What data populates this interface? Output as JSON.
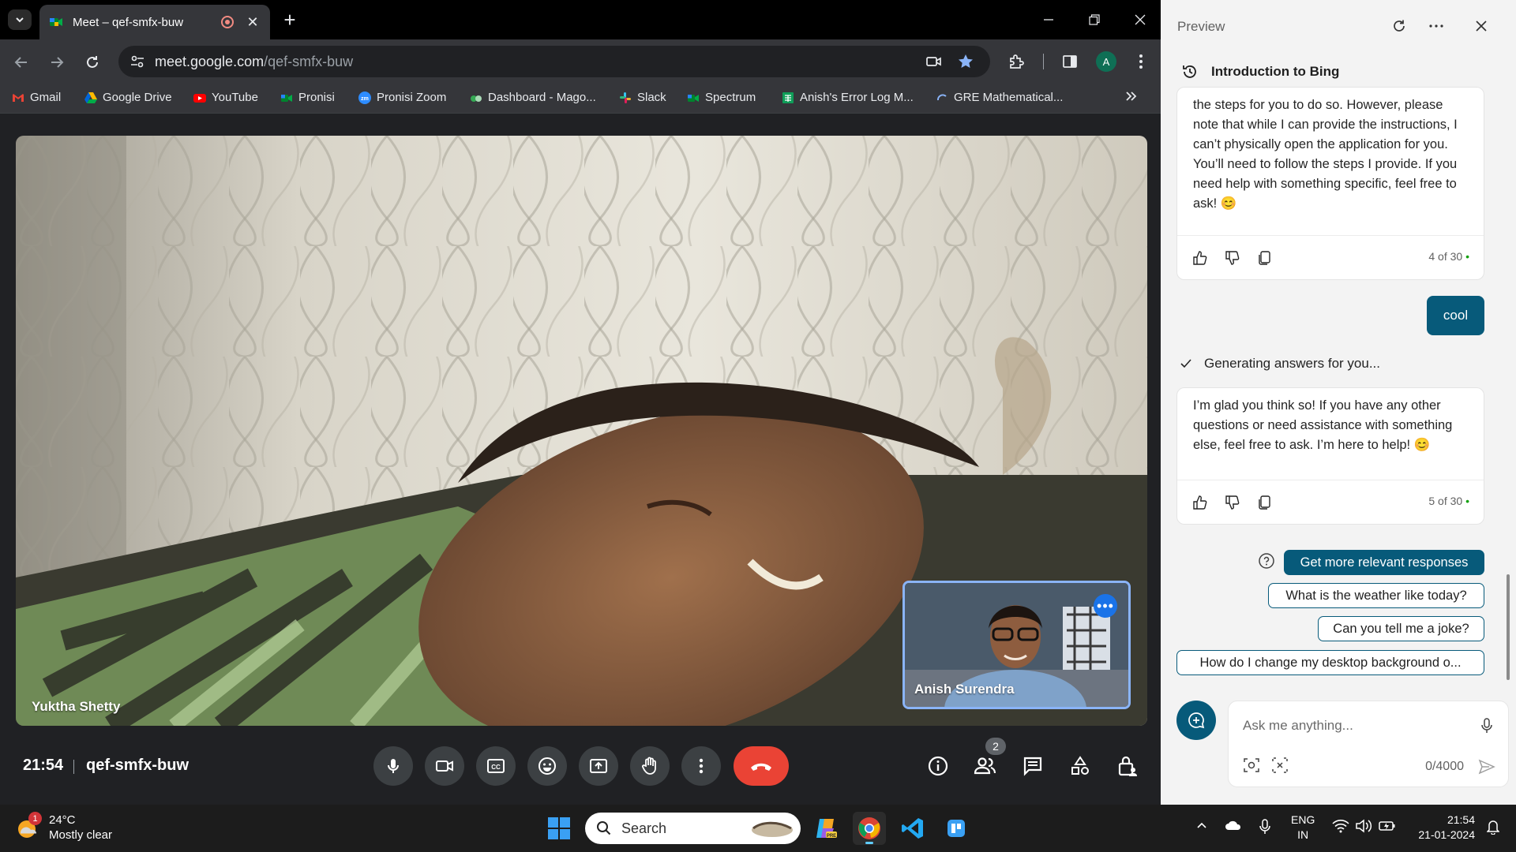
{
  "browser": {
    "tab_title": "Meet – qef-smfx-buw",
    "url_host": "meet.google.com",
    "url_path": "/qef-smfx-buw",
    "profile_initial": "A",
    "bookmarks": [
      {
        "label": "Gmail",
        "icon": "gmail-icon"
      },
      {
        "label": "Google Drive",
        "icon": "google-drive-icon"
      },
      {
        "label": "YouTube",
        "icon": "youtube-icon"
      },
      {
        "label": "Pronisi",
        "icon": "meet-icon"
      },
      {
        "label": "Pronisi Zoom",
        "icon": "zoom-icon"
      },
      {
        "label": "Dashboard - Mago...",
        "icon": "dashboard-icon"
      },
      {
        "label": "Slack",
        "icon": "slack-icon"
      },
      {
        "label": "Spectrum",
        "icon": "meet-icon"
      },
      {
        "label": "Anish's Error Log M...",
        "icon": "sheets-icon"
      },
      {
        "label": "GRE Mathematical...",
        "icon": "loader-icon"
      }
    ]
  },
  "meet": {
    "main_participant": "Yuktha Shetty",
    "self_participant": "Anish Surendra",
    "time": "21:54",
    "meeting_code": "qef-smfx-buw",
    "people_count": "2",
    "hangup_color": "#ea4335"
  },
  "copilot": {
    "header_title": "Preview",
    "conversation_title": "Introduction to Bing",
    "messages": [
      {
        "text": "the steps for you to do so. However, please note that while I can provide the instructions, I can’t physically open the application for you. You’ll need to follow the steps I provide. If you need help with something specific, feel free to ask! 😊",
        "count": "4 of 30"
      },
      {
        "text": "I’m glad you think so! If you have any other questions or need assistance with something else, feel free to ask. I’m here to help! 😊",
        "count": "5 of 30"
      }
    ],
    "user_message": "cool",
    "generating_text": "Generating answers for you...",
    "suggestions": [
      "Get more relevant responses",
      "What is the weather like today?",
      "Can you tell me a joke?",
      "How do I change my desktop background o..."
    ],
    "input_placeholder": "Ask me anything...",
    "char_count": "0/4000",
    "accent_color": "#075a7a"
  },
  "taskbar": {
    "weather_temp": "24°C",
    "weather_desc": "Mostly clear",
    "weather_badge": "1",
    "search_label": "Search",
    "lang_top": "ENG",
    "lang_bottom": "IN",
    "time": "21:54",
    "date": "21-01-2024"
  }
}
